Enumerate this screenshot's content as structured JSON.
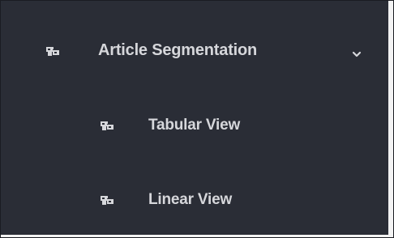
{
  "menu": {
    "parent": {
      "label": "Article Segmentation",
      "icon": "module-icon",
      "expanded": true,
      "chevron_icon": "chevron-down-icon"
    },
    "children": [
      {
        "label": "Tabular View",
        "icon": "module-icon"
      },
      {
        "label": "Linear View",
        "icon": "module-icon"
      }
    ]
  },
  "colors": {
    "background": "#2a2d36",
    "text": "#d6d7db",
    "icon": "#d6d7db"
  }
}
